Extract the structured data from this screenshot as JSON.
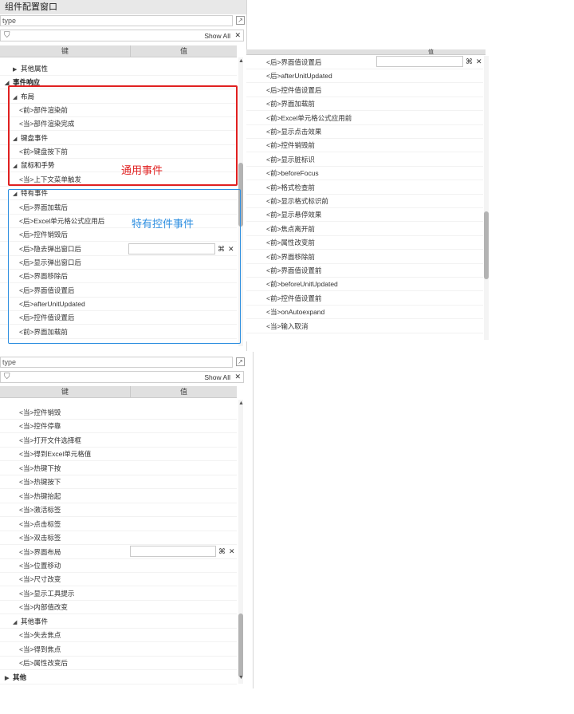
{
  "title": "组件配置窗口",
  "search_placeholder": "type",
  "show_all": "Show All",
  "close_glyph": "✕",
  "col_key": "键",
  "col_val": "值",
  "cmd_glyph": "⌘",
  "annotations": {
    "common": "通用事件",
    "special": "特有控件事件"
  },
  "panel1_rows": [
    {
      "label": "其他属性",
      "indent": 1,
      "tri": "▶"
    },
    {
      "label": "事件响应",
      "indent": 0,
      "tri": "◢",
      "bold": true
    },
    {
      "label": "布局",
      "indent": 1,
      "tri": "◢"
    },
    {
      "label": "<前>部件渲染前",
      "indent": 2
    },
    {
      "label": "<当>部件渲染完成",
      "indent": 2
    },
    {
      "label": "键盘事件",
      "indent": 1,
      "tri": "◢"
    },
    {
      "label": "<前>键盘按下前",
      "indent": 2
    },
    {
      "label": "鼠标和手势",
      "indent": 1,
      "tri": "◢"
    },
    {
      "label": "<当>上下文菜单触发",
      "indent": 2
    },
    {
      "label": "特有事件",
      "indent": 1,
      "tri": "◢"
    },
    {
      "label": "<后>界面加载后",
      "indent": 2
    },
    {
      "label": "<后>Excel单元格公式应用后",
      "indent": 2
    },
    {
      "label": "<后>控件销毁后",
      "indent": 2
    },
    {
      "label": "<后>隐去弹出窗口后",
      "indent": 2
    },
    {
      "label": "<后>显示弹出窗口后",
      "indent": 2
    },
    {
      "label": "<后>界面移除后",
      "indent": 2
    },
    {
      "label": "<后>界面值设置后",
      "indent": 2
    },
    {
      "label": "<后>afterUnitUpdated",
      "indent": 2
    },
    {
      "label": "<后>控件值设置后",
      "indent": 2
    },
    {
      "label": "<前>界面加载前",
      "indent": 2
    }
  ],
  "panel2_rows": [
    "<后>界面值设置后",
    "<后>afterUnitUpdated",
    "<后>控件值设置后",
    "<前>界面加载前",
    "<前>Excel单元格公式应用前",
    "<前>显示点击效果",
    "<前>控件销毁前",
    "<前>显示脏标识",
    "<前>beforeFocus",
    "<前>格式检查前",
    "<前>显示格式标识前",
    "<前>显示悬停效果",
    "<前>焦点离开前",
    "<前>属性改变前",
    "<前>界面移除前",
    "<前>界面值设置前",
    "<前>beforeUnitUpdated",
    "<前>控件值设置前",
    "<当>onAutoexpand",
    "<当>输入取消"
  ],
  "panel3_rows": [
    {
      "label": "<当>控件销毁",
      "indent": 2
    },
    {
      "label": "<当>控件停靠",
      "indent": 2
    },
    {
      "label": "<当>打开文件选择框",
      "indent": 2
    },
    {
      "label": "<当>得到Excel单元格值",
      "indent": 2
    },
    {
      "label": "<当>热键下按",
      "indent": 2
    },
    {
      "label": "<当>热键按下",
      "indent": 2
    },
    {
      "label": "<当>热键抬起",
      "indent": 2
    },
    {
      "label": "<当>激活标签",
      "indent": 2
    },
    {
      "label": "<当>点击标签",
      "indent": 2
    },
    {
      "label": "<当>双击标签",
      "indent": 2
    },
    {
      "label": "<当>界面布局",
      "indent": 2
    },
    {
      "label": "<当>位置移动",
      "indent": 2
    },
    {
      "label": "<当>尺寸改变",
      "indent": 2
    },
    {
      "label": "<当>显示工具提示",
      "indent": 2
    },
    {
      "label": "<当>内部值改变",
      "indent": 2
    },
    {
      "label": "其他事件",
      "indent": 1,
      "tri": "◢"
    },
    {
      "label": "<当>失去焦点",
      "indent": 2
    },
    {
      "label": "<当>得到焦点",
      "indent": 2
    },
    {
      "label": "<后>属性改变后",
      "indent": 2
    },
    {
      "label": "其他",
      "indent": 0,
      "tri": "▶",
      "bold": true
    }
  ],
  "colors": {
    "red": "#e02020",
    "blue": "#2f8fe0",
    "header": "#e0e0e0"
  },
  "icons": [
    "filter-icon",
    "expand-icon",
    "close-icon",
    "command-icon"
  ]
}
